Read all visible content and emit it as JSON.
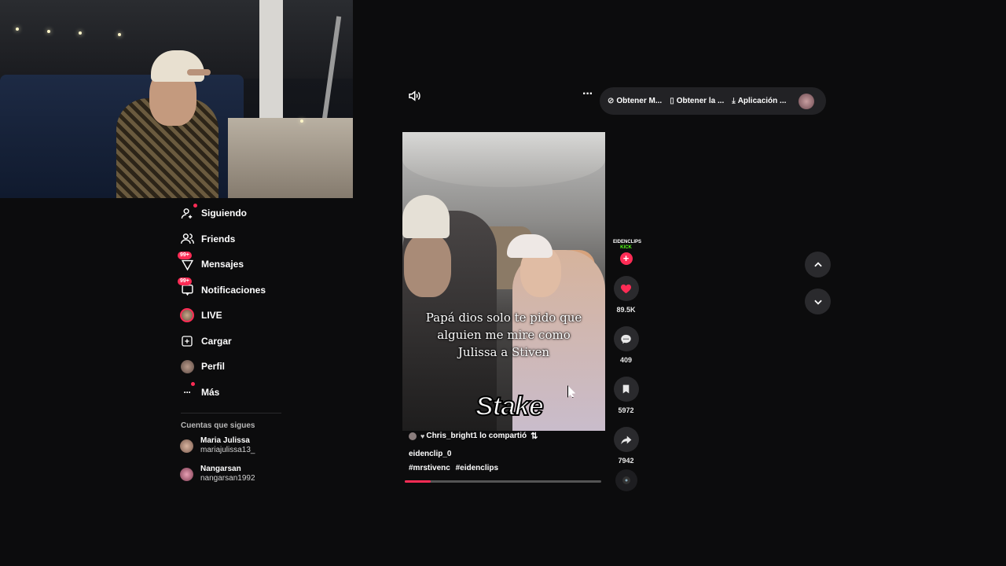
{
  "sidebar": {
    "items": [
      {
        "label": "Siguiendo",
        "icon": "following-icon"
      },
      {
        "label": "Friends",
        "icon": "friends-icon"
      },
      {
        "label": "Mensajes",
        "icon": "messages-icon",
        "badge": "99+"
      },
      {
        "label": "Notificaciones",
        "icon": "notifications-icon",
        "badge": "99+"
      },
      {
        "label": "LIVE",
        "icon": "live-avatar-icon"
      },
      {
        "label": "Cargar",
        "icon": "upload-icon"
      },
      {
        "label": "Perfil",
        "icon": "profile-avatar-icon"
      },
      {
        "label": "Más",
        "icon": "more-icon"
      }
    ],
    "section_title": "Cuentas que sigues",
    "accounts": [
      {
        "name": "Maria Julissa",
        "handle": "mariajulissa13_"
      },
      {
        "name": "Nangarsan",
        "handle": "nangarsan1992"
      }
    ]
  },
  "topbar": {
    "item1": "Obtener M...",
    "item2": "Obtener la ...",
    "item3": "Aplicación ..."
  },
  "video": {
    "caption_lines": "Papá dios solo te pido que alguien me mire como Julissa a Stiven",
    "watermark": "Stake",
    "repost_text": "Chris_bright1 lo compartió",
    "author": "eidenclip_0",
    "hashtags": [
      "#mrstivenc",
      "#eidenclips"
    ],
    "progress": 0.13
  },
  "actions": {
    "creator_logo_top": "EIDENCLIPS",
    "creator_logo_bottom": "KICK",
    "likes": "89.5K",
    "comments": "409",
    "saves": "5972",
    "shares": "7942"
  },
  "colors": {
    "accent": "#fe2c55",
    "background": "#0c0c0d",
    "button_bg": "#2a2a2d"
  }
}
